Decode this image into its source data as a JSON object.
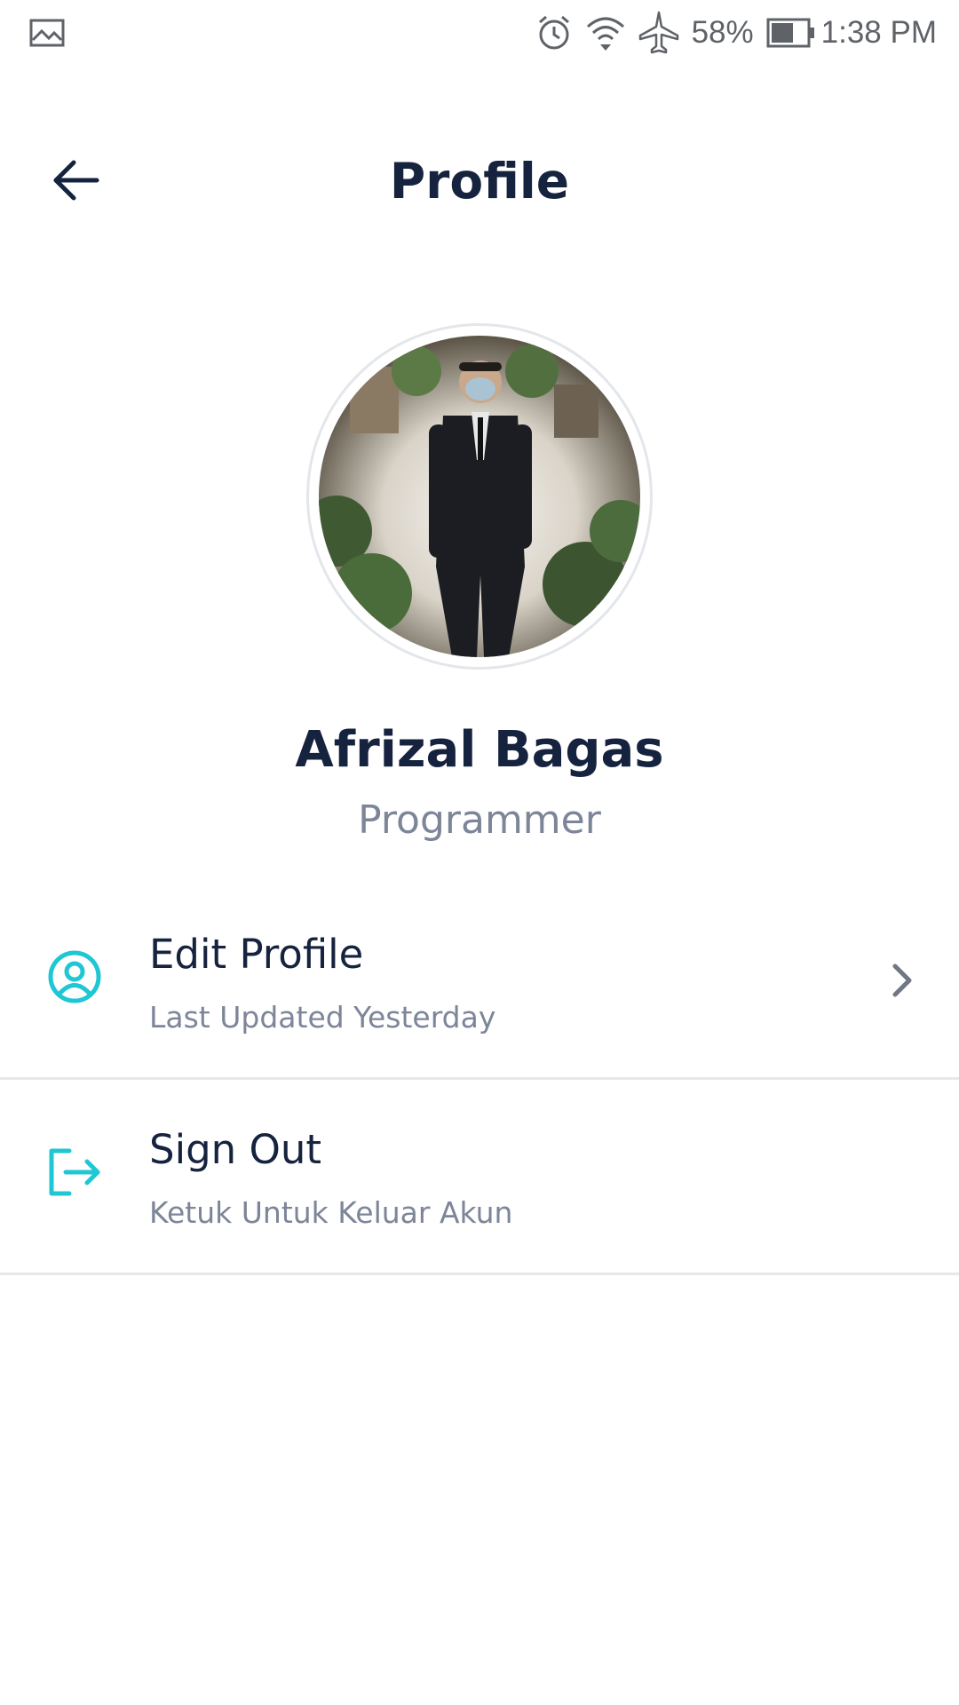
{
  "status_bar": {
    "battery_percent": "58%",
    "time": "1:38 PM",
    "icons": [
      "gallery-icon",
      "alarm-icon",
      "wifi-icon",
      "airplane-icon",
      "battery-icon"
    ]
  },
  "header": {
    "title": "Profile",
    "back_icon": "arrow-left-icon"
  },
  "profile": {
    "name": "Afrizal Bagas",
    "role": "Programmer"
  },
  "menu": {
    "items": [
      {
        "title": "Edit Profile",
        "subtitle": "Last Updated Yesterday",
        "icon": "user-circle-icon",
        "has_chevron": true
      },
      {
        "title": "Sign Out",
        "subtitle": "Ketuk Untuk Keluar Akun",
        "icon": "sign-out-icon",
        "has_chevron": false
      }
    ]
  },
  "colors": {
    "accent": "#1fc7d4",
    "title": "#16233f",
    "muted": "#7d8598",
    "divider": "#e6e8ec"
  }
}
